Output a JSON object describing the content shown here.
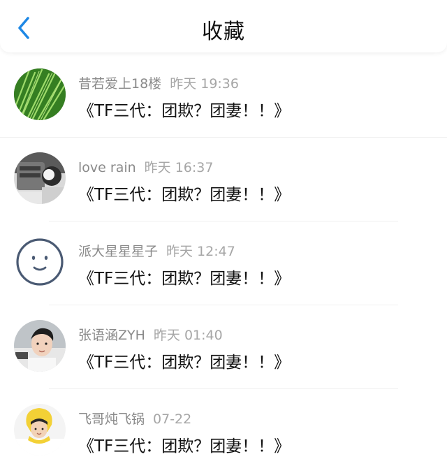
{
  "header": {
    "title": "收藏"
  },
  "items": [
    {
      "username": "昔若爱上18楼",
      "time": "昨天 19:36",
      "text": "《TF三代：团欺？团妻！！》",
      "avatar": "green-grass-avatar"
    },
    {
      "username": "love rain",
      "time": "昨天 16:37",
      "text": "《TF三代：团欺？团妻！！》",
      "avatar": "cartoon-photo-avatar"
    },
    {
      "username": "派大星星星子",
      "time": "昨天 12:47",
      "text": "《TF三代：团欺？团妻！！》",
      "avatar": "smiley-face-avatar"
    },
    {
      "username": "张语涵ZYH",
      "time": "昨天 01:40",
      "text": "《TF三代：团欺？团妻！！》",
      "avatar": "boy-photo-avatar"
    },
    {
      "username": "飞哥炖飞锅",
      "time": "07-22",
      "text": "《TF三代：团欺？团妻！！》",
      "avatar": "yellow-hat-avatar"
    }
  ],
  "colors": {
    "accent": "#1E88E5",
    "username": "#8a8a8a",
    "time": "#a6a6a6",
    "text": "#111111"
  }
}
